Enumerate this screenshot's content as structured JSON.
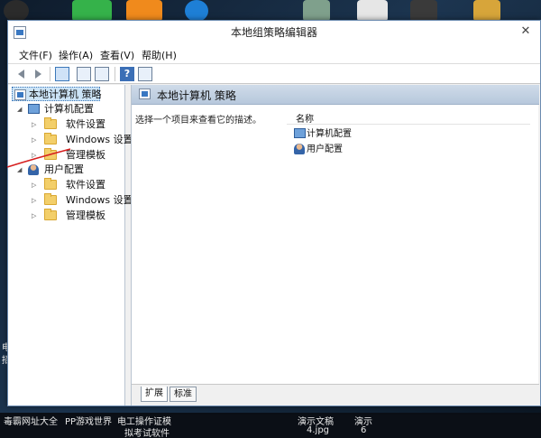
{
  "window": {
    "title": "本地组策略编辑器"
  },
  "menu": [
    "文件(F)",
    "操作(A)",
    "查看(V)",
    "帮助(H)"
  ],
  "tree": {
    "root": "本地计算机 策略",
    "computer": {
      "label": "计算机配置",
      "children": [
        "软件设置",
        "Windows 设置",
        "管理模板"
      ]
    },
    "user": {
      "label": "用户配置",
      "children": [
        "软件设置",
        "Windows 设置",
        "管理模板"
      ]
    }
  },
  "right": {
    "header": "本地计算机 策略",
    "description": "选择一个项目来查看它的描述。",
    "column_name": "名称",
    "items": [
      "计算机配置",
      "用户配置"
    ]
  },
  "tabs": [
    "扩展",
    "标准"
  ],
  "taskbar": [
    "毒霸网址大全",
    "PP游戏世界",
    "电工操作证模",
    "演示文稿",
    "演示",
    "拟考试软件",
    "4.jpg",
    "6"
  ],
  "desktop_fragments": [
    "电",
    "招"
  ],
  "colors": {
    "header_blue": "#b7c8dc",
    "selection": "#cce4f7",
    "folder": "#f3cf6a",
    "annotation_line": "#d61f1f"
  }
}
